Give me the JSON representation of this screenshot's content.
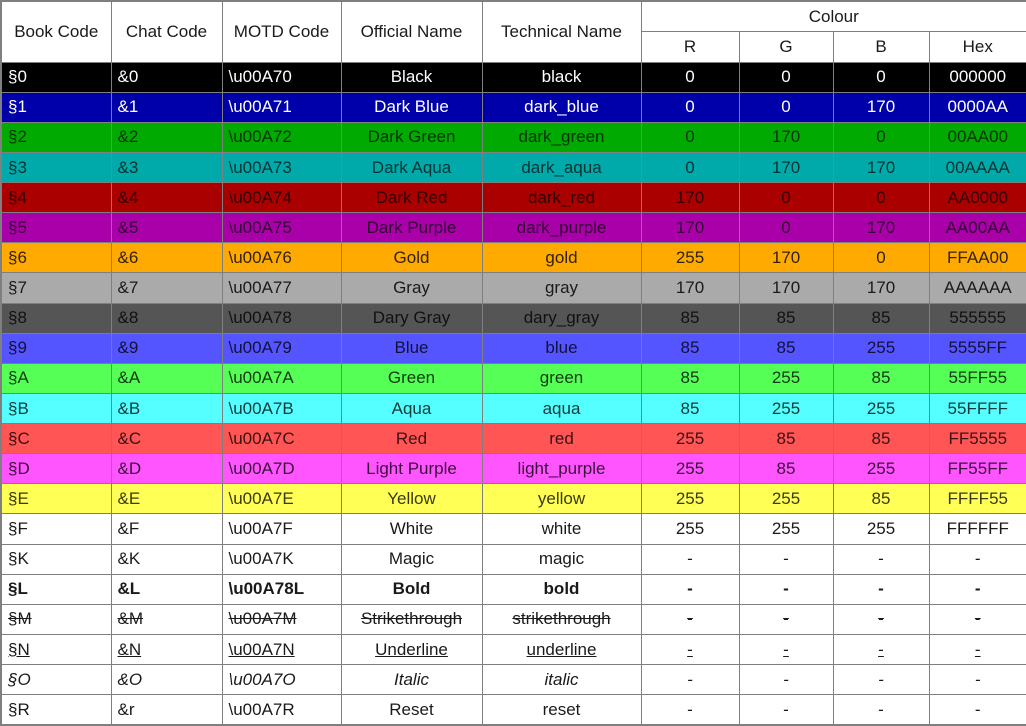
{
  "table": {
    "headers": {
      "book_code": "Book Code",
      "chat_code": "Chat Code",
      "motd_code": "MOTD Code",
      "official_name": "Official Name",
      "technical_name": "Technical Name",
      "colour": "Colour",
      "r": "R",
      "g": "G",
      "b": "B",
      "hex": "Hex"
    },
    "rows": [
      {
        "book_code": "§0",
        "chat_code": "&0",
        "motd_code": "\\u00A70",
        "official_name": "Black",
        "technical_name": "black",
        "r": "0",
        "g": "0",
        "b": "0",
        "hex": "000000",
        "bg": "#000000",
        "fg": "#ffffff",
        "style": ""
      },
      {
        "book_code": "§1",
        "chat_code": "&1",
        "motd_code": "\\u00A71",
        "official_name": "Dark Blue",
        "technical_name": "dark_blue",
        "r": "0",
        "g": "0",
        "b": "170",
        "hex": "0000AA",
        "bg": "#0000AA",
        "fg": "#ffffff",
        "style": ""
      },
      {
        "book_code": "§2",
        "chat_code": "&2",
        "motd_code": "\\u00A72",
        "official_name": "Dark Green",
        "technical_name": "dark_green",
        "r": "0",
        "g": "170",
        "b": "0",
        "hex": "00AA00",
        "bg": "#00AA00",
        "fg": "#003300",
        "style": ""
      },
      {
        "book_code": "§3",
        "chat_code": "&3",
        "motd_code": "\\u00A73",
        "official_name": "Dark Aqua",
        "technical_name": "dark_aqua",
        "r": "0",
        "g": "170",
        "b": "170",
        "hex": "00AAAA",
        "bg": "#00AAAA",
        "fg": "#003333",
        "style": ""
      },
      {
        "book_code": "§4",
        "chat_code": "&4",
        "motd_code": "\\u00A74",
        "official_name": "Dark Red",
        "technical_name": "dark_red",
        "r": "170",
        "g": "0",
        "b": "0",
        "hex": "AA0000",
        "bg": "#AA0000",
        "fg": "#330000",
        "style": ""
      },
      {
        "book_code": "§5",
        "chat_code": "&5",
        "motd_code": "\\u00A75",
        "official_name": "Dark Purple",
        "technical_name": "dark_purple",
        "r": "170",
        "g": "0",
        "b": "170",
        "hex": "AA00AA",
        "bg": "#AA00AA",
        "fg": "#330033",
        "style": ""
      },
      {
        "book_code": "§6",
        "chat_code": "&6",
        "motd_code": "\\u00A76",
        "official_name": "Gold",
        "technical_name": "gold",
        "r": "255",
        "g": "170",
        "b": "0",
        "hex": "FFAA00",
        "bg": "#FFAA00",
        "fg": "#332200",
        "style": ""
      },
      {
        "book_code": "§7",
        "chat_code": "&7",
        "motd_code": "\\u00A77",
        "official_name": "Gray",
        "technical_name": "gray",
        "r": "170",
        "g": "170",
        "b": "170",
        "hex": "AAAAAA",
        "bg": "#AAAAAA",
        "fg": "#1a1a1a",
        "style": ""
      },
      {
        "book_code": "§8",
        "chat_code": "&8",
        "motd_code": "\\u00A78",
        "official_name": "Dary Gray",
        "technical_name": "dary_gray",
        "r": "85",
        "g": "85",
        "b": "85",
        "hex": "555555",
        "bg": "#555555",
        "fg": "#111111",
        "style": ""
      },
      {
        "book_code": "§9",
        "chat_code": "&9",
        "motd_code": "\\u00A79",
        "official_name": "Blue",
        "technical_name": "blue",
        "r": "85",
        "g": "85",
        "b": "255",
        "hex": "5555FF",
        "bg": "#5555FF",
        "fg": "#11113a",
        "style": ""
      },
      {
        "book_code": "§A",
        "chat_code": "&A",
        "motd_code": "\\u00A7A",
        "official_name": "Green",
        "technical_name": "green",
        "r": "85",
        "g": "255",
        "b": "85",
        "hex": "55FF55",
        "bg": "#55FF55",
        "fg": "#113a11",
        "style": ""
      },
      {
        "book_code": "§B",
        "chat_code": "&B",
        "motd_code": "\\u00A7B",
        "official_name": "Aqua",
        "technical_name": "aqua",
        "r": "85",
        "g": "255",
        "b": "255",
        "hex": "55FFFF",
        "bg": "#55FFFF",
        "fg": "#113a3a",
        "style": ""
      },
      {
        "book_code": "§C",
        "chat_code": "&C",
        "motd_code": "\\u00A7C",
        "official_name": "Red",
        "technical_name": "red",
        "r": "255",
        "g": "85",
        "b": "85",
        "hex": "FF5555",
        "bg": "#FF5555",
        "fg": "#3a1111",
        "style": ""
      },
      {
        "book_code": "§D",
        "chat_code": "&D",
        "motd_code": "\\u00A7D",
        "official_name": "Light Purple",
        "technical_name": "light_purple",
        "r": "255",
        "g": "85",
        "b": "255",
        "hex": "FF55FF",
        "bg": "#FF55FF",
        "fg": "#3a113a",
        "style": ""
      },
      {
        "book_code": "§E",
        "chat_code": "&E",
        "motd_code": "\\u00A7E",
        "official_name": "Yellow",
        "technical_name": "yellow",
        "r": "255",
        "g": "255",
        "b": "85",
        "hex": "FFFF55",
        "bg": "#FFFF55",
        "fg": "#3a3a11",
        "style": ""
      },
      {
        "book_code": "§F",
        "chat_code": "&F",
        "motd_code": "\\u00A7F",
        "official_name": "White",
        "technical_name": "white",
        "r": "255",
        "g": "255",
        "b": "255",
        "hex": "FFFFFF",
        "bg": "#FFFFFF",
        "fg": "#1a1a1a",
        "style": ""
      },
      {
        "book_code": "§K",
        "chat_code": "&K",
        "motd_code": "\\u00A7K",
        "official_name": "Magic",
        "technical_name": "magic",
        "r": "-",
        "g": "-",
        "b": "-",
        "hex": "-",
        "bg": "#FFFFFF",
        "fg": "#1a1a1a",
        "style": ""
      },
      {
        "book_code": "§L",
        "chat_code": "&L",
        "motd_code": "\\u00A78L",
        "official_name": "Bold",
        "technical_name": "bold",
        "r": "-",
        "g": "-",
        "b": "-",
        "hex": "-",
        "bg": "#FFFFFF",
        "fg": "#1a1a1a",
        "style": "bd"
      },
      {
        "book_code": "§M",
        "chat_code": "&M",
        "motd_code": "\\u00A7M",
        "official_name": "Strikethrough",
        "technical_name": "strikethrough",
        "r": "-",
        "g": "-",
        "b": "-",
        "hex": "-",
        "bg": "#FFFFFF",
        "fg": "#1a1a1a",
        "style": "st"
      },
      {
        "book_code": "§N",
        "chat_code": "&N",
        "motd_code": "\\u00A7N",
        "official_name": "Underline",
        "technical_name": "underline",
        "r": "-",
        "g": "-",
        "b": "-",
        "hex": "-",
        "bg": "#FFFFFF",
        "fg": "#1a1a1a",
        "style": "ul"
      },
      {
        "book_code": "§O",
        "chat_code": "&O",
        "motd_code": "\\u00A7O",
        "official_name": "Italic",
        "technical_name": "italic",
        "r": "-",
        "g": "-",
        "b": "-",
        "hex": "-",
        "bg": "#FFFFFF",
        "fg": "#1a1a1a",
        "style": "it"
      },
      {
        "book_code": "§R",
        "chat_code": "&r",
        "motd_code": "\\u00A7R",
        "official_name": "Reset",
        "technical_name": "reset",
        "r": "-",
        "g": "-",
        "b": "-",
        "hex": "-",
        "bg": "#FFFFFF",
        "fg": "#1a1a1a",
        "style": ""
      }
    ]
  }
}
